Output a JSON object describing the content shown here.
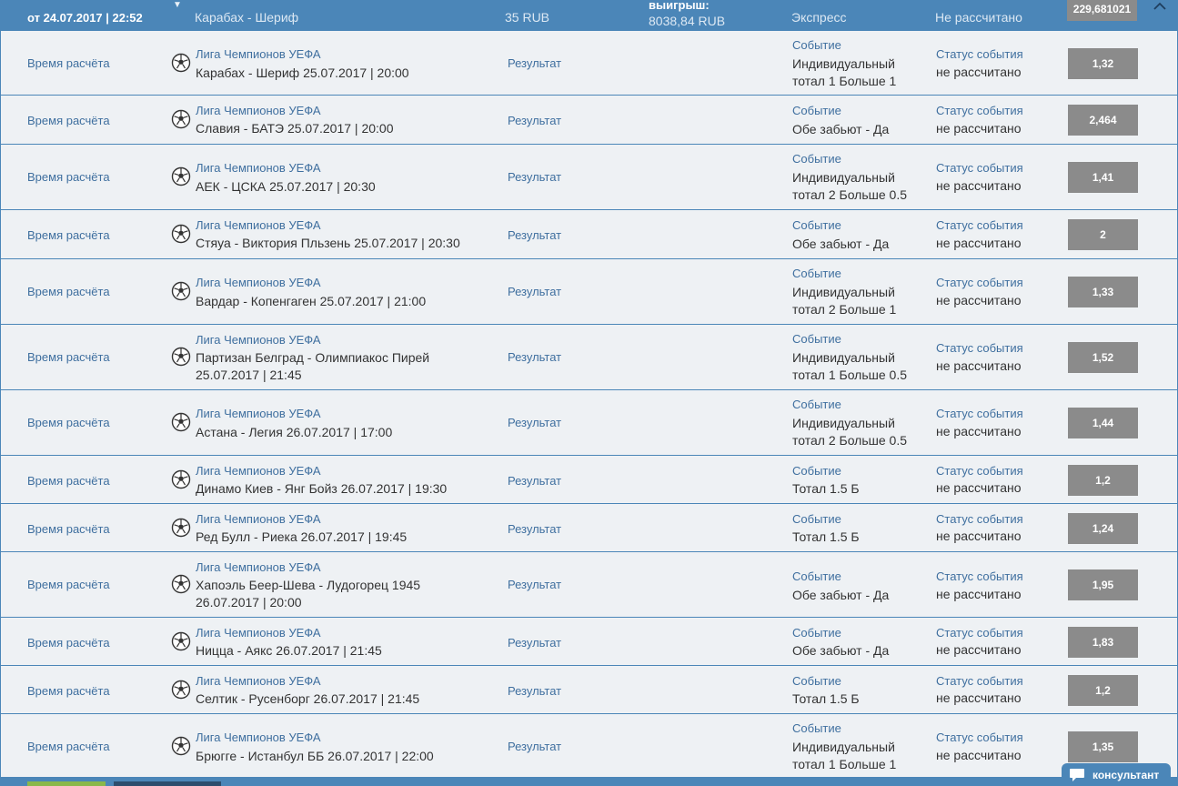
{
  "header": {
    "date": "от 24.07.2017 | 22:52",
    "match": "Карабах - Шериф",
    "stake": "35 RUB",
    "win_label": "выигрыш:",
    "win_value": "8038,84 RUB",
    "bet_type": "Экспресс",
    "status": "Не рассчитано",
    "bet_id": "229,681021"
  },
  "labels": {
    "calc_time": "Время расчёта",
    "result": "Результат",
    "event": "Событие",
    "event_status": "Статус события"
  },
  "rows": [
    {
      "league": "Лига Чемпионов УЕФА",
      "match": "Карабах - Шериф 25.07.2017 | 20:00",
      "event": "Индивидуальный тотал 1 Больше 1",
      "status": "не рассчитано",
      "odds": "1,32"
    },
    {
      "league": "Лига Чемпионов УЕФА",
      "match": "Славия - БАТЭ 25.07.2017 | 20:00",
      "event": "Обе забьют - Да",
      "status": "не рассчитано",
      "odds": "2,464"
    },
    {
      "league": "Лига Чемпионов УЕФА",
      "match": "АЕК - ЦСКА 25.07.2017 | 20:30",
      "event": "Индивидуальный тотал 2 Больше 0.5",
      "status": "не рассчитано",
      "odds": "1,41"
    },
    {
      "league": "Лига Чемпионов УЕФА",
      "match": "Стяуа - Виктория Пльзень 25.07.2017 | 20:30",
      "event": "Обе забьют - Да",
      "status": "не рассчитано",
      "odds": "2"
    },
    {
      "league": "Лига Чемпионов УЕФА",
      "match": "Вардар - Копенгаген 25.07.2017 | 21:00",
      "event": "Индивидуальный тотал 2 Больше 1",
      "status": "не рассчитано",
      "odds": "1,33"
    },
    {
      "league": "Лига Чемпионов УЕФА",
      "match": "Партизан Белград - Олимпиакос Пирей 25.07.2017 | 21:45",
      "event": "Индивидуальный тотал 1 Больше 0.5",
      "status": "не рассчитано",
      "odds": "1,52"
    },
    {
      "league": "Лига Чемпионов УЕФА",
      "match": "Астана - Легия 26.07.2017 | 17:00",
      "event": "Индивидуальный тотал 2 Больше 0.5",
      "status": "не рассчитано",
      "odds": "1,44"
    },
    {
      "league": "Лига Чемпионов УЕФА",
      "match": "Динамо Киев - Янг Бойз 26.07.2017 | 19:30",
      "event": "Тотал 1.5 Б",
      "status": "не рассчитано",
      "odds": "1,2"
    },
    {
      "league": "Лига Чемпионов УЕФА",
      "match": "Ред Булл - Риека 26.07.2017 | 19:45",
      "event": "Тотал 1.5 Б",
      "status": "не рассчитано",
      "odds": "1,24"
    },
    {
      "league": "Лига Чемпионов УЕФА",
      "match": "Хапоэль Беер-Шева - Лудогорец 1945 26.07.2017 | 20:00",
      "event": "Обе забьют - Да",
      "status": "не рассчитано",
      "odds": "1,95"
    },
    {
      "league": "Лига Чемпионов УЕФА",
      "match": "Ницца - Аякс 26.07.2017 | 21:45",
      "event": "Обе забьют - Да",
      "status": "не рассчитано",
      "odds": "1,83"
    },
    {
      "league": "Лига Чемпионов УЕФА",
      "match": "Селтик - Русенборг 26.07.2017 | 21:45",
      "event": "Тотал 1.5 Б",
      "status": "не рассчитано",
      "odds": "1,2"
    },
    {
      "league": "Лига Чемпионов УЕФА",
      "match": "Брюгге - Истанбул ББ 26.07.2017 | 22:00",
      "event": "Индивидуальный тотал 1 Больше 1",
      "status": "не рассчитано",
      "odds": "1,35"
    }
  ],
  "consultant": {
    "label": "консультант"
  },
  "icons": {
    "sport": "soccer-ball-icon",
    "collapse": "chevron-up-icon",
    "expand": "caret-down-icon",
    "chat": "chat-bubble-icon"
  },
  "colors": {
    "accent": "#4b86b8",
    "row_bg": "#eef1f4",
    "odds_bg": "#8b8b8b",
    "link": "#3f6f9f"
  }
}
